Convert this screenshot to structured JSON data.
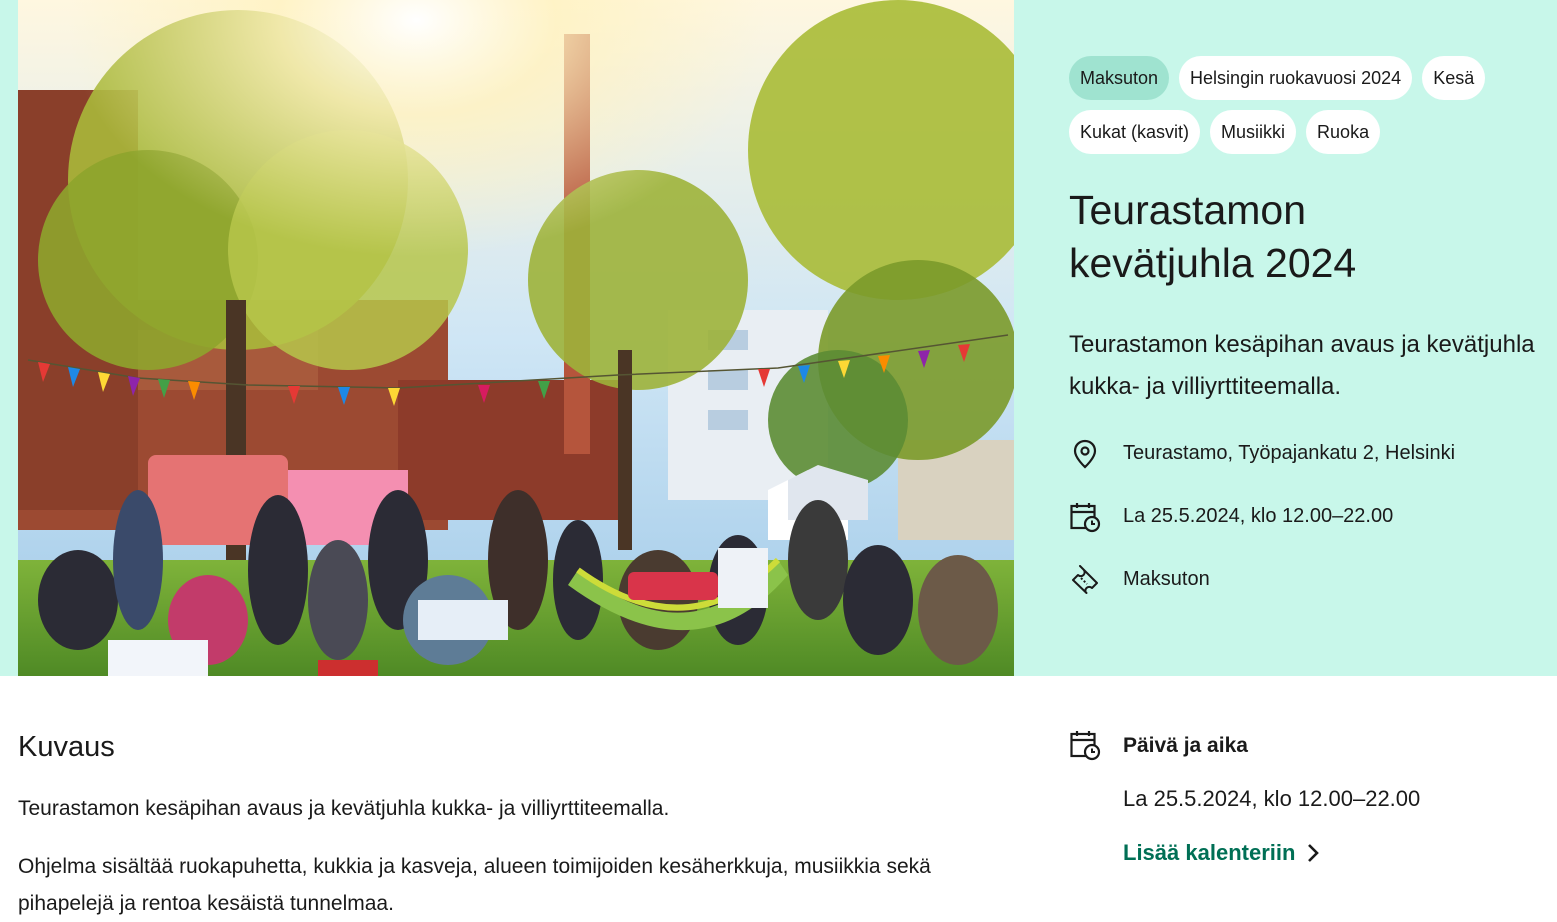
{
  "hero": {
    "image_alt": "Teurastamon kevätjuhla – outdoor festival crowd under trees with bunting flags",
    "tags": [
      {
        "label": "Maksuton",
        "active": true
      },
      {
        "label": "Helsingin ruokavuosi 2024",
        "active": false
      },
      {
        "label": "Kesä",
        "active": false
      },
      {
        "label": "Kukat (kasvit)",
        "active": false
      },
      {
        "label": "Musiikki",
        "active": false
      },
      {
        "label": "Ruoka",
        "active": false
      }
    ],
    "title_line1": "Teurastamon",
    "title_line2": "kevätjuhla 2024",
    "lead": "Teurastamon kesäpihan avaus ja kevätjuhla kukka- ja villiyrttiteemalla.",
    "location": "Teurastamo, Työpajankatu 2, Helsinki",
    "datetime": "La 25.5.2024, klo 12.00–22.00",
    "price": "Maksuton"
  },
  "description": {
    "heading": "Kuvaus",
    "paragraph1": "Teurastamon kesäpihan avaus ja kevätjuhla kukka- ja villiyrttiteemalla.",
    "paragraph2": "Ohjelma sisältää ruokapuhetta, kukkia ja kasveja, alueen toimijoiden kesäherkkuja, musiikkia sekä pihapelejä ja rentoa kesäistä tunnelmaa."
  },
  "sidebar": {
    "heading": "Päivä ja aika",
    "date": "La 25.5.2024, klo 12.00–22.00",
    "add_to_calendar": "Lisää kalenteriin"
  },
  "colors": {
    "hero_bg": "#c8f7ea",
    "active_tag": "#9fe3d0",
    "link": "#006f55",
    "text": "#1a1a1a"
  }
}
